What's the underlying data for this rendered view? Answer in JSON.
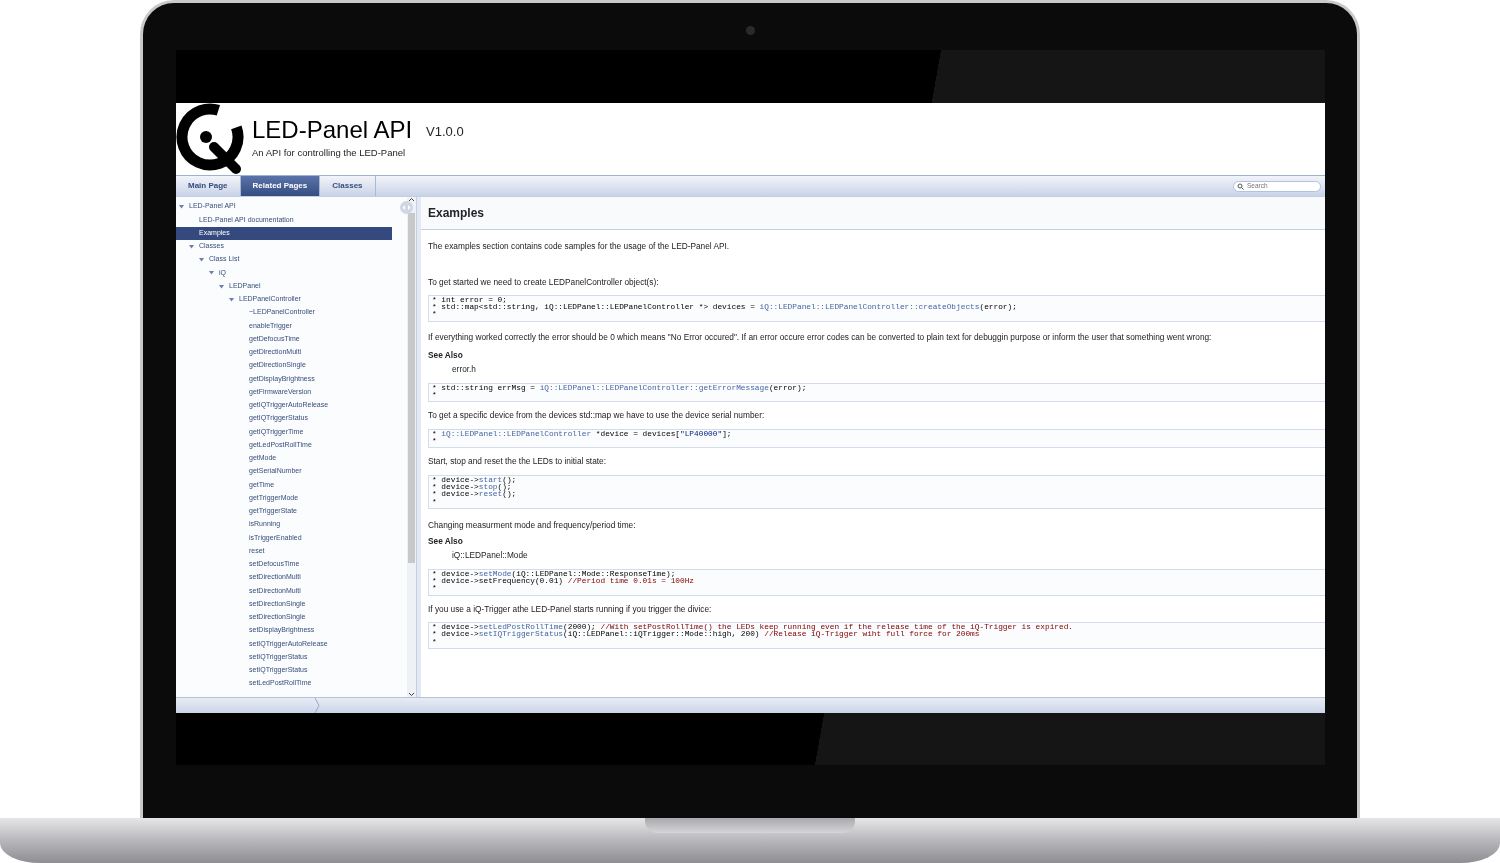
{
  "header": {
    "title": "LED-Panel API",
    "version": "V1.0.0",
    "subtitle": "An API for controlling the LED-Panel"
  },
  "tabs": [
    {
      "label": "Main Page",
      "selected": false
    },
    {
      "label": "Related Pages",
      "selected": true
    },
    {
      "label": "Classes",
      "selected": false
    }
  ],
  "search": {
    "placeholder": "Search"
  },
  "tree": [
    {
      "label": "LED-Panel API",
      "selected": false,
      "expanded": true,
      "children": [
        {
          "label": "LED-Panel API documentation",
          "selected": false
        },
        {
          "label": "Examples",
          "selected": true
        },
        {
          "label": "Classes",
          "selected": false,
          "expanded": true,
          "children": [
            {
              "label": "Class List",
              "selected": false,
              "expanded": true,
              "children": [
                {
                  "label": "iQ",
                  "selected": false,
                  "expanded": true,
                  "children": [
                    {
                      "label": "LEDPanel",
                      "selected": false,
                      "expanded": true,
                      "children": [
                        {
                          "label": "LEDPanelController",
                          "selected": false,
                          "expanded": true,
                          "children": [
                            {
                              "label": "~LEDPanelController",
                              "selected": false
                            },
                            {
                              "label": "enableTrigger",
                              "selected": false
                            },
                            {
                              "label": "getDefocusTime",
                              "selected": false
                            },
                            {
                              "label": "getDirectionMulti",
                              "selected": false
                            },
                            {
                              "label": "getDirectionSingle",
                              "selected": false
                            },
                            {
                              "label": "getDisplayBrightness",
                              "selected": false
                            },
                            {
                              "label": "getFirmwareVersion",
                              "selected": false
                            },
                            {
                              "label": "getIQTriggerAutoRelease",
                              "selected": false
                            },
                            {
                              "label": "getIQTriggerStatus",
                              "selected": false
                            },
                            {
                              "label": "getIQTriggerTime",
                              "selected": false
                            },
                            {
                              "label": "getLedPostRollTime",
                              "selected": false
                            },
                            {
                              "label": "getMode",
                              "selected": false
                            },
                            {
                              "label": "getSerialNumber",
                              "selected": false
                            },
                            {
                              "label": "getTime",
                              "selected": false
                            },
                            {
                              "label": "getTriggerMode",
                              "selected": false
                            },
                            {
                              "label": "getTriggerState",
                              "selected": false
                            },
                            {
                              "label": "isRunning",
                              "selected": false
                            },
                            {
                              "label": "isTriggerEnabled",
                              "selected": false
                            },
                            {
                              "label": "reset",
                              "selected": false
                            },
                            {
                              "label": "setDefocusTime",
                              "selected": false
                            },
                            {
                              "label": "setDirectionMulti",
                              "selected": false
                            },
                            {
                              "label": "setDirectionMulti",
                              "selected": false
                            },
                            {
                              "label": "setDirectionSingle",
                              "selected": false
                            },
                            {
                              "label": "setDirectionSingle",
                              "selected": false
                            },
                            {
                              "label": "setDisplayBrightness",
                              "selected": false
                            },
                            {
                              "label": "setIQTriggerAutoRelease",
                              "selected": false
                            },
                            {
                              "label": "setIQTriggerStatus",
                              "selected": false
                            },
                            {
                              "label": "setIQTriggerStatus",
                              "selected": false
                            },
                            {
                              "label": "setLedPostRollTime",
                              "selected": false
                            }
                          ]
                        }
                      ]
                    }
                  ]
                }
              ]
            }
          ]
        }
      ]
    }
  ],
  "content": {
    "title": "Examples",
    "blocks": [
      {
        "kind": "text",
        "text": "The examples section contains code samples for the usage of the LED-Panel API."
      },
      {
        "kind": "text",
        "text": "To get started we need to create LEDPanelController object(s):"
      },
      {
        "kind": "code",
        "lines": [
          [
            {
              "kind": "plain",
              "text": "* int error = 0;"
            }
          ],
          [
            {
              "kind": "plain",
              "text": "* std::map<std::string, iQ::LEDPanel::LEDPanelController *> devices = "
            },
            {
              "kind": "link",
              "text": "iQ::LEDPanel::LEDPanelController::createObjects"
            },
            {
              "kind": "plain",
              "text": "(error);"
            }
          ],
          [
            {
              "kind": "plain",
              "text": "*"
            }
          ]
        ]
      },
      {
        "kind": "text",
        "text": "If everything worked correctly the error should be 0 which means \"No Error occured\". If an error occure error codes can be converted to plain text for debuggin purpose or inform the user that something went wrong:"
      },
      {
        "kind": "see_also",
        "heading": "See Also",
        "text": "error.h"
      },
      {
        "kind": "code",
        "lines": [
          [
            {
              "kind": "plain",
              "text": "* std::string errMsg = "
            },
            {
              "kind": "link",
              "text": "iQ::LEDPanel::LEDPanelController::getErrorMessage"
            },
            {
              "kind": "plain",
              "text": "(error);"
            }
          ],
          [
            {
              "kind": "plain",
              "text": "*"
            }
          ]
        ]
      },
      {
        "kind": "text",
        "text": "To get a specific device from the devices std::map we have to use the device serial number:"
      },
      {
        "kind": "code",
        "lines": [
          [
            {
              "kind": "plain",
              "text": "* "
            },
            {
              "kind": "link",
              "text": "iQ::LEDPanel::LEDPanelController"
            },
            {
              "kind": "plain",
              "text": " *device = devices["
            },
            {
              "kind": "string",
              "text": "\"LP40000\""
            },
            {
              "kind": "plain",
              "text": "];"
            }
          ],
          [
            {
              "kind": "plain",
              "text": "*"
            }
          ]
        ]
      },
      {
        "kind": "text",
        "text": "Start, stop and reset the the LEDs to initial state:"
      },
      {
        "kind": "code",
        "lines": [
          [
            {
              "kind": "plain",
              "text": "* device->"
            },
            {
              "kind": "link",
              "text": "start"
            },
            {
              "kind": "plain",
              "text": "();"
            }
          ],
          [
            {
              "kind": "plain",
              "text": "* device->"
            },
            {
              "kind": "link",
              "text": "stop"
            },
            {
              "kind": "plain",
              "text": "();"
            }
          ],
          [
            {
              "kind": "plain",
              "text": "* device->"
            },
            {
              "kind": "link",
              "text": "reset"
            },
            {
              "kind": "plain",
              "text": "();"
            }
          ],
          [
            {
              "kind": "plain",
              "text": "*"
            }
          ]
        ]
      },
      {
        "kind": "text",
        "text": "Changing measurment mode and frequency/period time:"
      },
      {
        "kind": "see_also",
        "heading": "See Also",
        "text": "iQ::LEDPanel::Mode"
      },
      {
        "kind": "code",
        "lines": [
          [
            {
              "kind": "plain",
              "text": "* device->"
            },
            {
              "kind": "link",
              "text": "setMode"
            },
            {
              "kind": "plain",
              "text": "(iQ::LEDPanel::Mode::ResponseTime);"
            }
          ],
          [
            {
              "kind": "plain",
              "text": "* device->setFrequency(0.01) "
            },
            {
              "kind": "comment",
              "text": "//Period time 0.01s = 100Hz"
            }
          ],
          [
            {
              "kind": "plain",
              "text": "*"
            }
          ]
        ]
      },
      {
        "kind": "text",
        "text": "If you use a iQ-Trigger athe LED-Panel starts running if you trigger the divice:"
      },
      {
        "kind": "code",
        "lines": [
          [
            {
              "kind": "plain",
              "text": "* device->"
            },
            {
              "kind": "link",
              "text": "setLedPostRollTime"
            },
            {
              "kind": "plain",
              "text": "(2000); "
            },
            {
              "kind": "comment",
              "text": "//With setPostRollTime() the LEDs keep running even if the release time of the iQ-Trigger is expired."
            }
          ],
          [
            {
              "kind": "plain",
              "text": "* device->"
            },
            {
              "kind": "link",
              "text": "setIQTriggerStatus"
            },
            {
              "kind": "plain",
              "text": "(iQ::LEDPanel::iQTrigger::Mode::high, 200) "
            },
            {
              "kind": "comment",
              "text": "//Release iQ-Trigger wiht full force for 200ms"
            }
          ],
          [
            {
              "kind": "plain",
              "text": "*"
            }
          ]
        ]
      }
    ]
  }
}
